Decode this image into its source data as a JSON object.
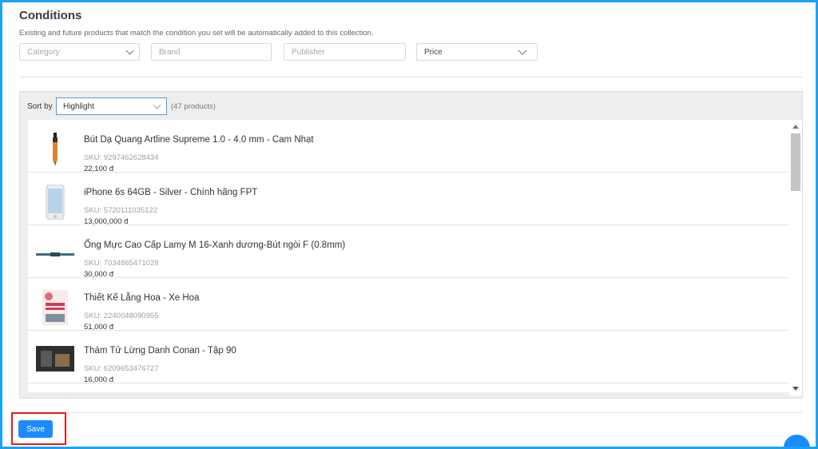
{
  "section": {
    "title": "Conditions",
    "description": "Existing and future products that match the condition you set will be automatically added to this collection."
  },
  "filters": {
    "category": "Category",
    "brand": "Brand",
    "publisher": "Publisher",
    "price": "Price"
  },
  "sort": {
    "label": "Sort by",
    "selected": "Highlight",
    "count": "(47 products)"
  },
  "products": [
    {
      "name": "Bút Dạ Quang Artline Supreme 1.0 - 4.0 mm - Cam Nhạt",
      "sku": "SKU: 9297462628434",
      "price": "22,100 đ"
    },
    {
      "name": "iPhone 6s 64GB - Silver - Chính hãng FPT",
      "sku": "SKU: 5720111035122",
      "price": "13,000,000 đ"
    },
    {
      "name": "Ống Mực Cao Cấp Lamy M 16-Xanh dương-Bút ngòi F (0.8mm)",
      "sku": "SKU: 7034865471029",
      "price": "30,000 đ"
    },
    {
      "name": "Thiết Kế Lẵng Hoa - Xe Hoa",
      "sku": "SKU: 2240048090955",
      "price": "51,000 đ"
    },
    {
      "name": "Thám Tử Lừng Danh Conan - Tập 90",
      "sku": "SKU: 6209653476727",
      "price": "16,000 đ"
    }
  ],
  "actions": {
    "save_label": "Save"
  },
  "colors": {
    "accent": "#1a8cff",
    "frame": "#1da1f2",
    "highlight": "#e51c1c"
  }
}
